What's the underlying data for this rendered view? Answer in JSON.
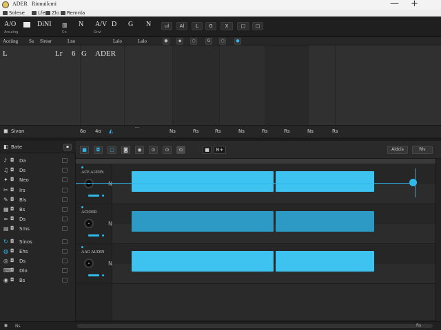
{
  "titlebar": {
    "app_name": "ADER",
    "project_name": "Rionuilcmi",
    "minimize_glyph": "—",
    "maximize_glyph": "+"
  },
  "menubar": {
    "items": [
      {
        "label": "Solese",
        "icon": "file-icon"
      },
      {
        "label": "Lfe",
        "icon": "edit-icon"
      },
      {
        "label": "Zlo",
        "icon": "view-icon"
      },
      {
        "label": "Remnla",
        "icon": "window-icon"
      }
    ]
  },
  "toolbar": {
    "label_1": "A/O",
    "label_2": "DiNI",
    "label_3": "N",
    "label_4": "A/V",
    "label_5": "D",
    "label_6": "G",
    "label_7": "N",
    "sub_1": "Arcuiing",
    "sub_2": "Cn",
    "sub_3": "Gnvi",
    "buttons": [
      "ul",
      "Al",
      "L",
      "G",
      "X",
      "□"
    ]
  },
  "toolbar2": {
    "item_1": "Aceiing",
    "item_2": "Sa",
    "item_3": "Sirear",
    "item_4": "Lno",
    "item_5": "Lalo",
    "buttons": [
      "●",
      "◆",
      "○",
      "G",
      "●"
    ]
  },
  "upper": {
    "header_1": "L",
    "header_2": "Lr",
    "header_3": "6",
    "header_4": "G",
    "header_5": "ADER"
  },
  "upperfoot": {
    "label": "Sivan",
    "items": [
      "6o",
      "4o",
      "Ns",
      "Rs",
      "Rs",
      "Ns",
      "Rs",
      "Rs",
      "Ns",
      "Rs"
    ]
  },
  "browser": {
    "header": "Bate",
    "items": [
      {
        "icon": "mic-icon",
        "label": "Da"
      },
      {
        "icon": "note-icon",
        "label": "Ds"
      },
      {
        "icon": "fx-icon",
        "label": "Neo"
      },
      {
        "icon": "scissors-icon",
        "label": "Irs"
      },
      {
        "icon": "pen-icon",
        "label": "Bls"
      },
      {
        "icon": "grid-icon",
        "label": "Bs"
      },
      {
        "icon": "link-icon",
        "label": "Ds"
      },
      {
        "icon": "sample-icon",
        "label": "Sms"
      },
      {
        "icon": "loop-icon",
        "label": "Sinos"
      },
      {
        "icon": "drum-icon",
        "label": "Ehs"
      },
      {
        "icon": "synth-icon",
        "label": "Ds"
      },
      {
        "icon": "key-icon",
        "label": "Dlo"
      },
      {
        "icon": "vocal-icon",
        "label": "Bs"
      }
    ]
  },
  "arrangement_toolbar": {
    "buttons": [
      "■",
      "◘",
      "□",
      "◙",
      "◉",
      "⊙",
      "⊙",
      "⊙",
      "⊙"
    ],
    "center_1": "■",
    "center_2": "B+",
    "right_1": "Aidcis",
    "right_2": "Rlv"
  },
  "tracks": [
    {
      "name": "ACE AUDIN",
      "side": "N"
    },
    {
      "name": "ACIOER",
      "side": "N"
    },
    {
      "name": "AAG AUDIN",
      "side": "N"
    }
  ],
  "statusbar": {
    "s1": "◼",
    "s2": "Ns",
    "s3": "Rs"
  },
  "colors": {
    "accent": "#2fb8ea",
    "clip_bright": "#3ec2ef",
    "clip_dim": "#2d9ac6",
    "background": "#2a2a2a"
  }
}
